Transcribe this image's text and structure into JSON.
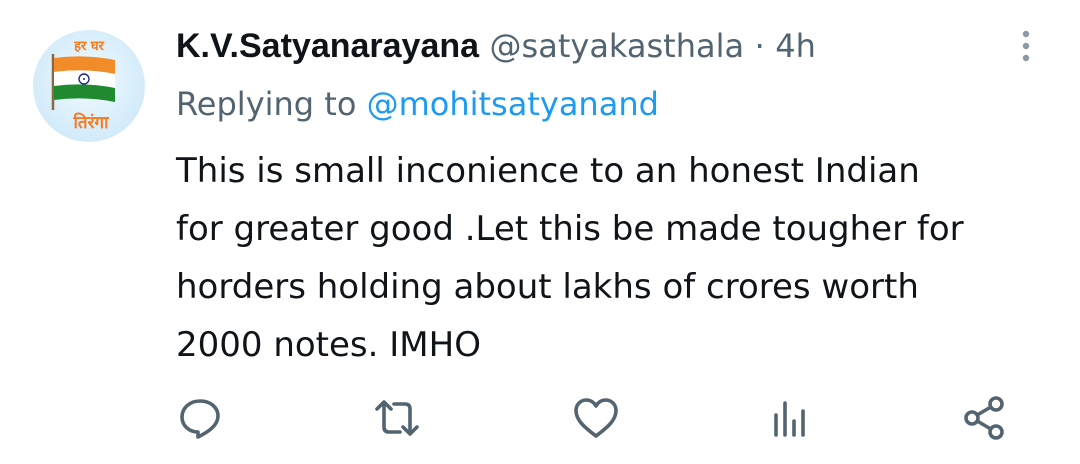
{
  "tweet": {
    "avatar": {
      "top_text": "हर घर",
      "bottom_text": "तिरंगा",
      "flag_colors": {
        "saffron": "#f28c28",
        "white": "#ffffff",
        "green": "#1f8a2e",
        "chakra": "#1c2a8a"
      }
    },
    "display_name": "K.V.Satyanarayana",
    "handle": "@satyakasthala",
    "separator": "·",
    "time": "4h",
    "replying_prefix": "Replying to",
    "replying_handle": "@mohitsatyanand",
    "text": "This is small inconience to an honest Indian\nfor greater good .Let this be made tougher for\nhorders holding about lakhs of crores worth\n2000 notes. IMHO",
    "actions": [
      {
        "name": "reply",
        "icon": "reply-icon"
      },
      {
        "name": "retweet",
        "icon": "retweet-icon"
      },
      {
        "name": "like",
        "icon": "heart-icon"
      },
      {
        "name": "views",
        "icon": "views-icon"
      },
      {
        "name": "share",
        "icon": "share-icon"
      }
    ],
    "colors": {
      "text_primary": "#0f1419",
      "text_secondary": "#536471",
      "link": "#1d9bf0",
      "avatar_text": "#f47b20"
    }
  }
}
